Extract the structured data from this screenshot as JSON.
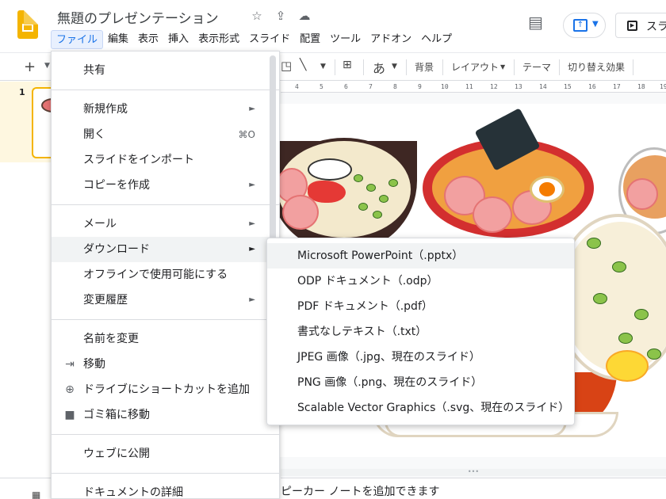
{
  "doc": {
    "title": "無題のプレゼンテーション"
  },
  "menubar": [
    "ファイル",
    "編集",
    "表示",
    "挿入",
    "表示形式",
    "スライド",
    "配置",
    "ツール",
    "アドオン",
    "ヘルプ"
  ],
  "header": {
    "slideshow_label": "スラ"
  },
  "toolbar": {
    "lang_char": "あ",
    "background": "背景",
    "layout": "レイアウト",
    "theme": "テーマ",
    "transition": "切り替え効果"
  },
  "ruler": [
    "4",
    "5",
    "6",
    "7",
    "8",
    "9",
    "10",
    "11",
    "12",
    "13",
    "14",
    "15",
    "16",
    "17",
    "18",
    "19"
  ],
  "filmstrip": {
    "slide_number": "1"
  },
  "notes": {
    "placeholder": "ピーカー ノートを追加できます"
  },
  "file_menu": {
    "items": [
      {
        "label": "共有"
      },
      {
        "label": "新規作成",
        "submenu": true
      },
      {
        "label": "開く",
        "shortcut": "⌘O"
      },
      {
        "label": "スライドをインポート"
      },
      {
        "label": "コピーを作成",
        "submenu": true
      },
      {
        "label": "メール",
        "submenu": true
      },
      {
        "label": "ダウンロード",
        "submenu": true,
        "highlighted": true
      },
      {
        "label": "オフラインで使用可能にする"
      },
      {
        "label": "変更履歴",
        "submenu": true
      },
      {
        "label": "名前を変更"
      },
      {
        "label": "移動",
        "icon": "folder-move-icon"
      },
      {
        "label": "ドライブにショートカットを追加",
        "icon": "drive-shortcut-icon"
      },
      {
        "label": "ゴミ箱に移動",
        "icon": "trash-icon"
      },
      {
        "label": "ウェブに公開"
      },
      {
        "label": "ドキュメントの詳細"
      }
    ]
  },
  "download_submenu": {
    "items": [
      "Microsoft PowerPoint（.pptx）",
      "ODP ドキュメント（.odp）",
      "PDF ドキュメント（.pdf）",
      "書式なしテキスト（.txt）",
      "JPEG 画像（.jpg、現在のスライド）",
      "PNG 画像（.png、現在のスライド）",
      "Scalable Vector Graphics（.svg、現在のスライド）"
    ],
    "highlighted_index": 0
  }
}
